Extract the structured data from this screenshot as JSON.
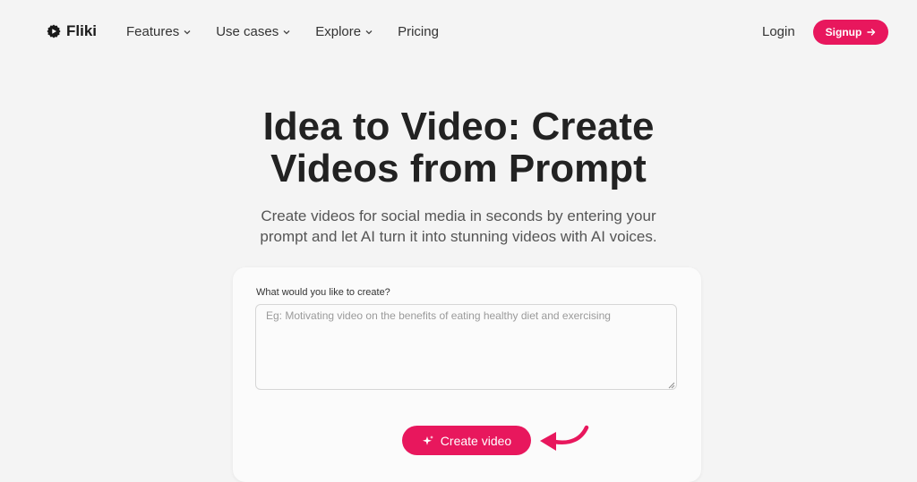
{
  "header": {
    "brand": "Fliki",
    "menu": [
      {
        "label": "Features",
        "has_dropdown": true
      },
      {
        "label": "Use cases",
        "has_dropdown": true
      },
      {
        "label": "Explore",
        "has_dropdown": true
      },
      {
        "label": "Pricing",
        "has_dropdown": false
      }
    ],
    "login_label": "Login",
    "signup_label": "Signup"
  },
  "hero": {
    "title_line1": "Idea to Video: Create",
    "title_line2": "Videos from Prompt",
    "subtitle_line1": "Create videos for social media in seconds by entering your",
    "subtitle_line2": "prompt and let AI turn it into stunning videos with AI voices."
  },
  "form": {
    "label": "What would you like to create?",
    "value": "",
    "placeholder": "Eg: Motivating video on the benefits of eating healthy diet and exercising",
    "button_label": "Create video"
  },
  "colors": {
    "accent": "#e8175d",
    "background": "#f4f4f4",
    "card": "#fbfbfb"
  },
  "icons": {
    "logo": "play-gear-icon",
    "chevron": "chevron-down-icon",
    "signup_arrow": "arrow-right-icon",
    "button_icon": "sparkles-icon",
    "pointer": "curved-arrow-icon"
  }
}
